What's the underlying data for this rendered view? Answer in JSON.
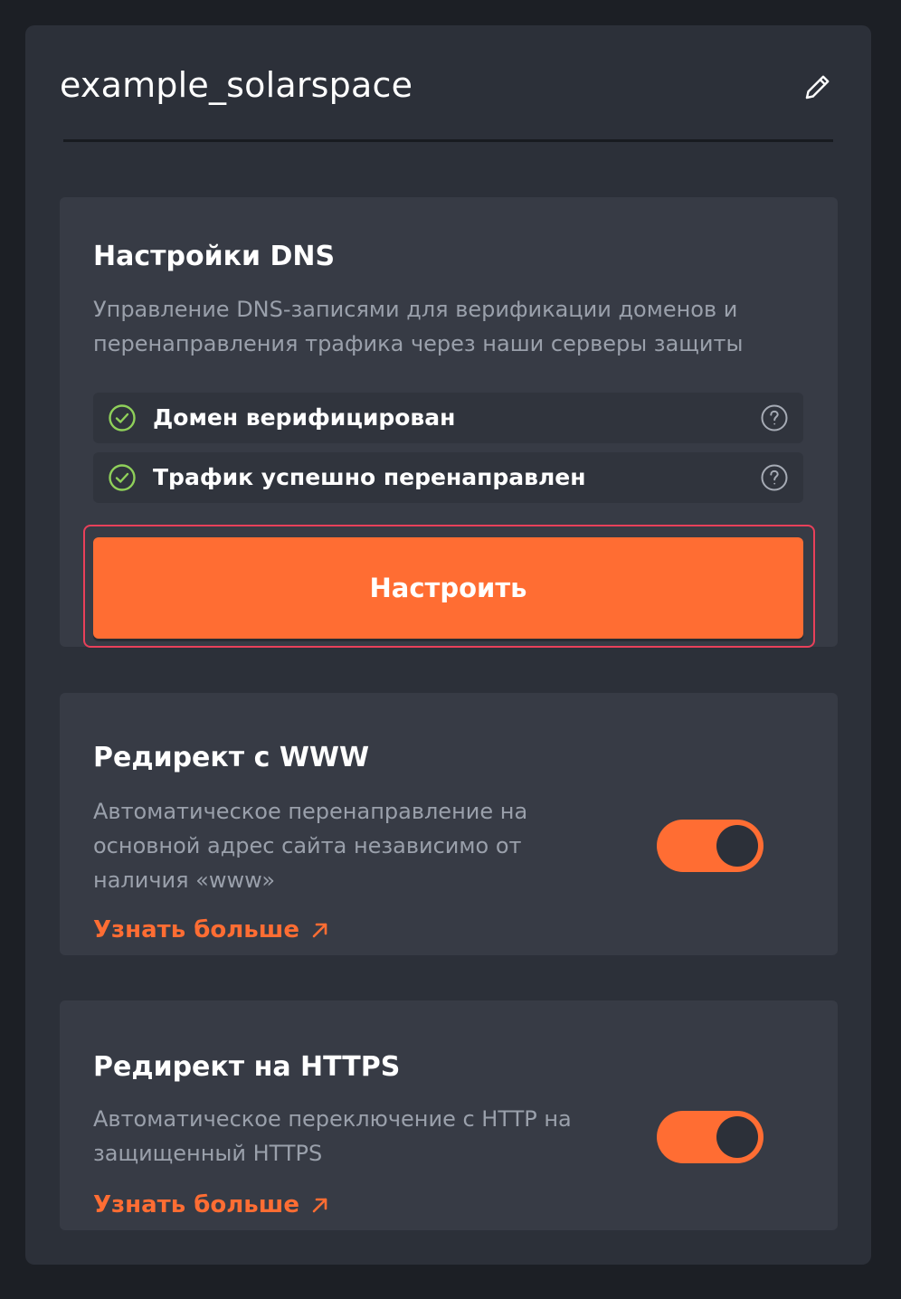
{
  "header": {
    "site_name": "example_solarspace",
    "edit_icon": "pencil-icon"
  },
  "dns": {
    "title": "Настройки DNS",
    "description": "Управление DNS-записями для верификации доменов и перенаправления трафика через наши серверы защиты",
    "statuses": [
      {
        "label": "Домен верифицирован",
        "icon": "check-circle-icon",
        "help_icon": "question-circle-icon"
      },
      {
        "label": "Трафик успешно перенаправлен",
        "icon": "check-circle-icon",
        "help_icon": "question-circle-icon"
      }
    ],
    "button_label": "Настроить"
  },
  "www_redirect": {
    "title": "Редирект с WWW",
    "description": "Автоматическое перенаправление на основной адрес сайта независимо от наличия «www»",
    "learn_more": "Узнать больше",
    "enabled": true
  },
  "https_redirect": {
    "title": "Редирект на HTTPS",
    "description": "Автоматическое переключение с HTTP на защищенный HTTPS",
    "learn_more": "Узнать больше",
    "enabled": true
  },
  "colors": {
    "accent": "#ff6d33",
    "success": "#8fd05a",
    "panel": "#2c3039",
    "card": "#373b45",
    "highlight_outline": "#e8405a"
  }
}
